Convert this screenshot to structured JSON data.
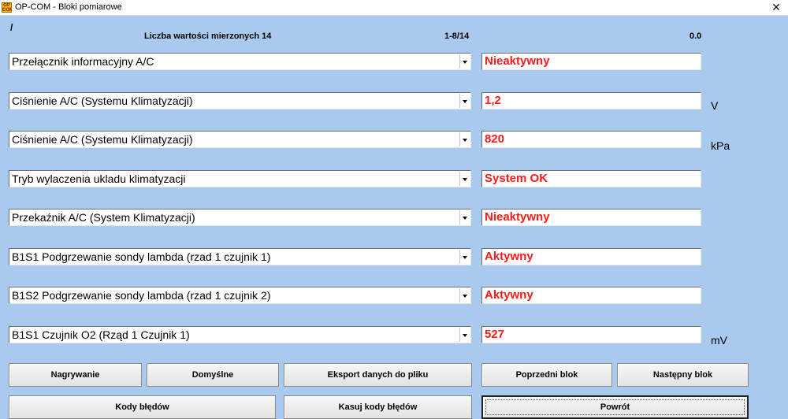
{
  "window": {
    "title": "OP-COM - Bloki pomiarowe",
    "icon_text": "OP COM"
  },
  "header": {
    "slash": "/",
    "count_label": "Liczba wartości mierzonych 14",
    "range": "1-8/14",
    "time": "0.0"
  },
  "rows": [
    {
      "label": "Przełącznik informacyjny A/C",
      "value": "Nieaktywny",
      "unit": ""
    },
    {
      "label": "Ciśnienie A/C (Systemu Klimatyzacji)",
      "value": "1,2",
      "unit": "V"
    },
    {
      "label": "Ciśnienie A/C (Systemu Klimatyzacji)",
      "value": "820",
      "unit": "kPa"
    },
    {
      "label": "Tryb wylaczenia ukladu klimatyzacji",
      "value": "System OK",
      "unit": ""
    },
    {
      "label": "Przekaźnik A/C (System Klimatyzacji)",
      "value": "Nieaktywny",
      "unit": ""
    },
    {
      "label": "B1S1 Podgrzewanie sondy lambda (rzad 1 czujnik 1)",
      "value": "Aktywny",
      "unit": ""
    },
    {
      "label": "B1S2 Podgrzewanie sondy lambda (rzad 1 czujnik 2)",
      "value": "Aktywny",
      "unit": ""
    },
    {
      "label": "B1S1 Czujnik O2 (Rząd 1 Czujnik 1)",
      "value": "527",
      "unit": "mV"
    }
  ],
  "buttons": {
    "record": "Nagrywanie",
    "defaults": "Domyślne",
    "export": "Eksport danych do pliku",
    "prev_block": "Poprzedni blok",
    "next_block": "Następny blok",
    "error_codes": "Kody błędów",
    "clear_codes": "Kasuj kody błędów",
    "back": "Powrót"
  },
  "colors": {
    "background": "#a9c9ee",
    "value_text": "#ff1a1a"
  }
}
